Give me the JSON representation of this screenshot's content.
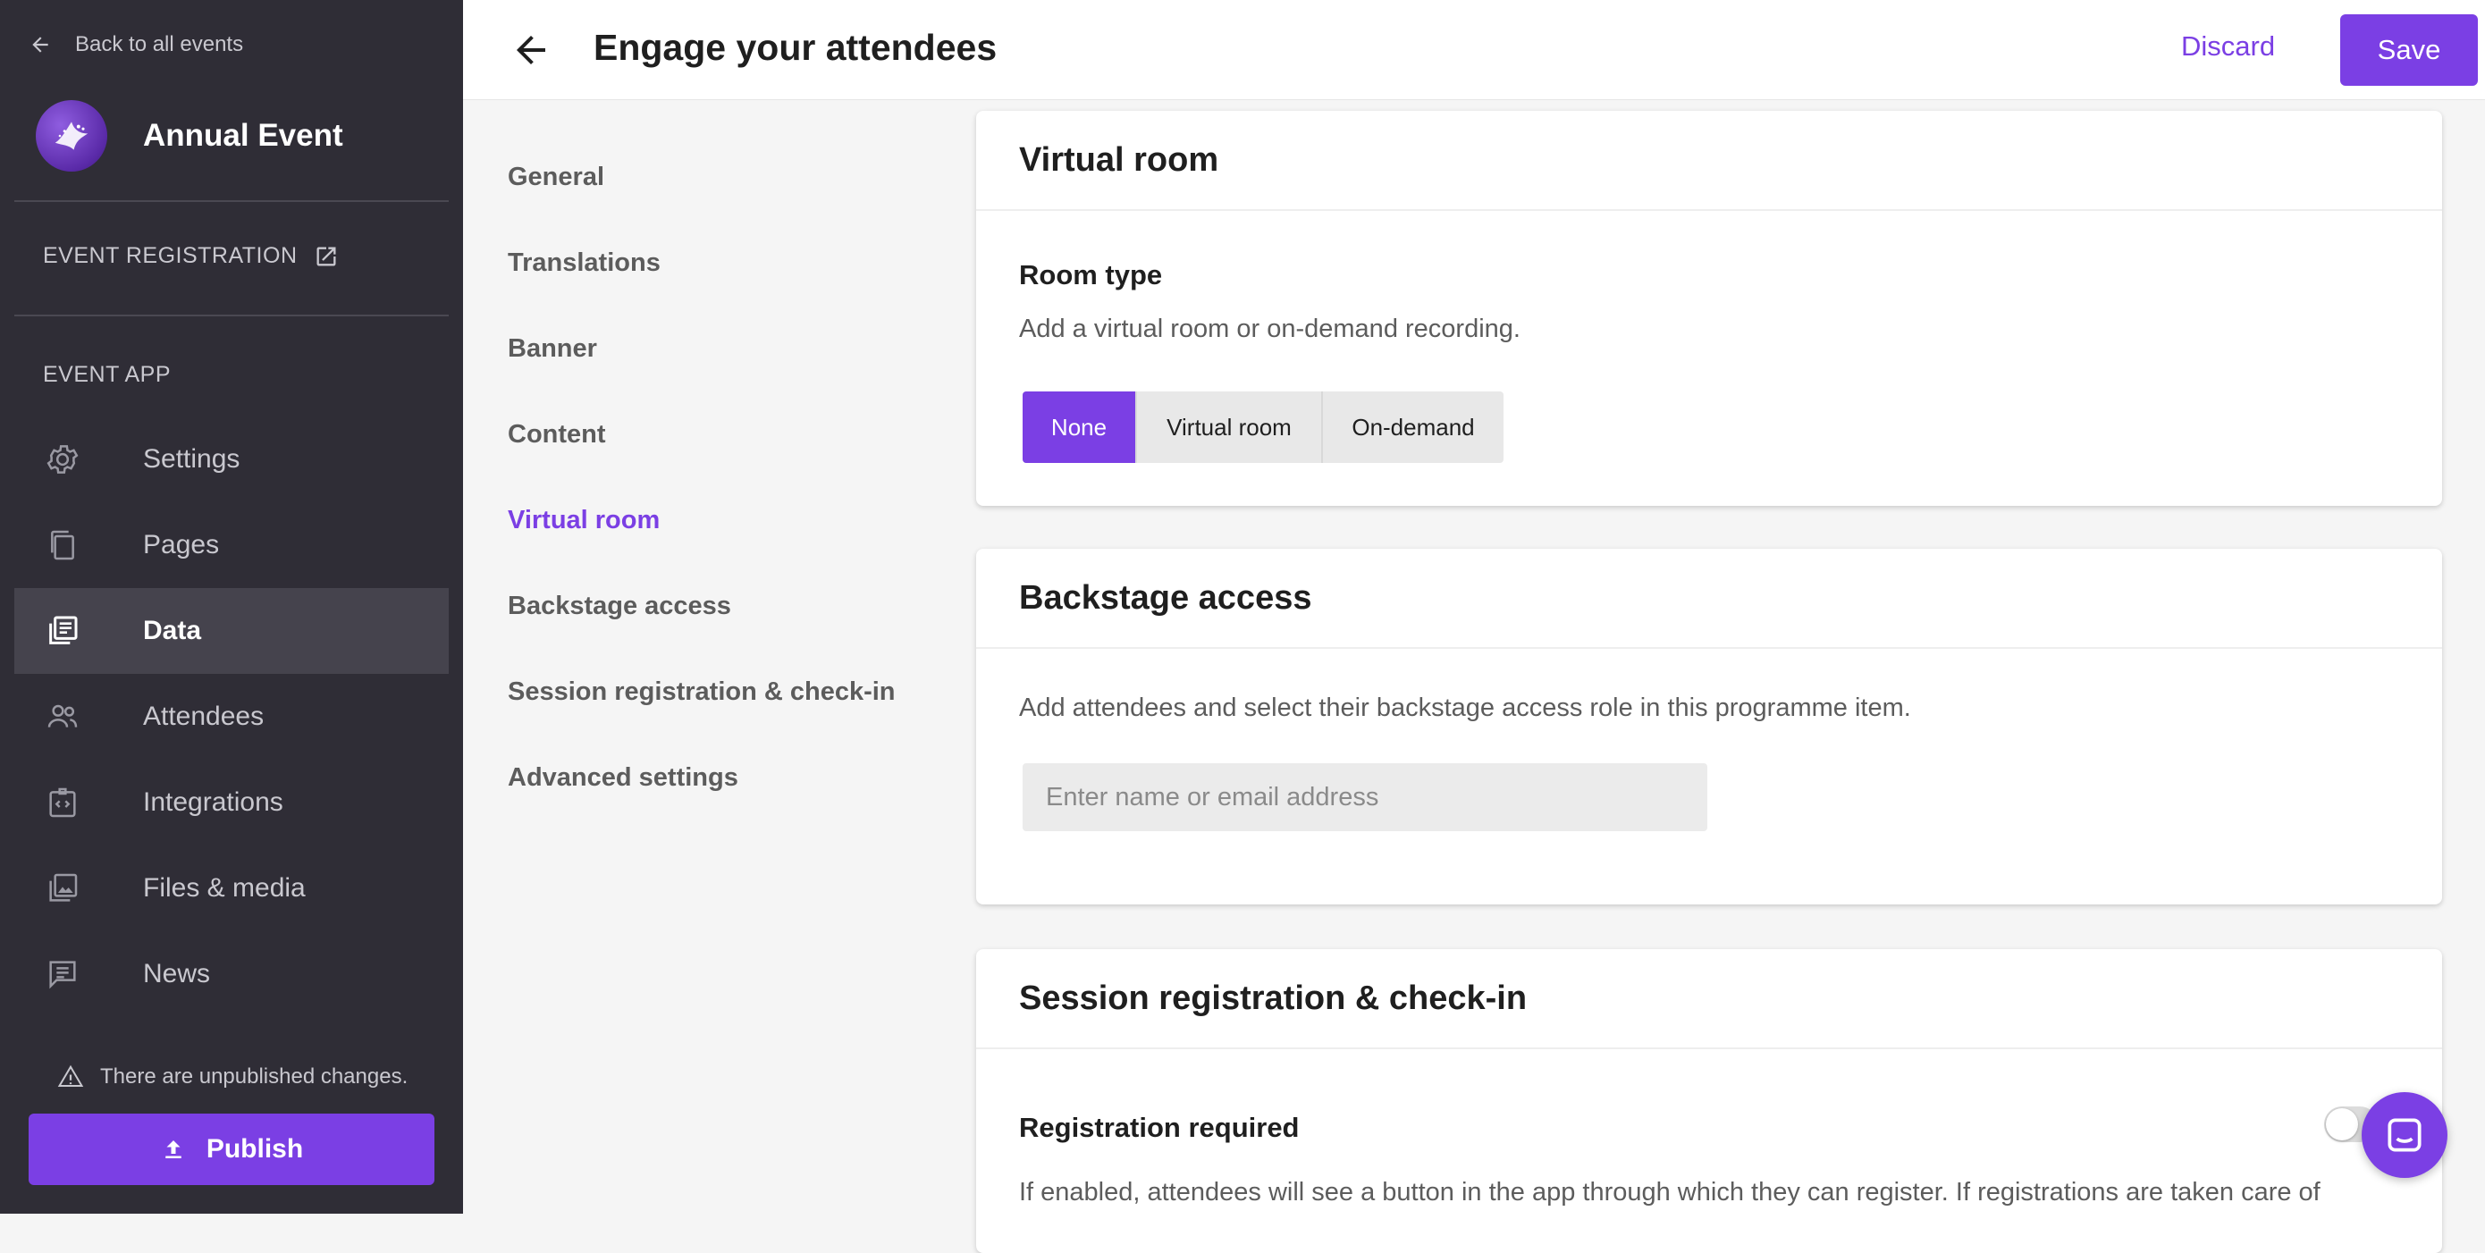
{
  "sidebar": {
    "back_label": "Back to all events",
    "event_name": "Annual Event",
    "registration_label": "EVENT REGISTRATION",
    "app_label": "EVENT APP",
    "items": [
      {
        "label": "Settings",
        "icon": "gear-icon"
      },
      {
        "label": "Pages",
        "icon": "pages-icon"
      },
      {
        "label": "Data",
        "icon": "data-icon",
        "active": true
      },
      {
        "label": "Attendees",
        "icon": "people-icon"
      },
      {
        "label": "Integrations",
        "icon": "integrations-icon"
      },
      {
        "label": "Files & media",
        "icon": "media-icon"
      },
      {
        "label": "News",
        "icon": "news-icon"
      }
    ],
    "unpublished_text": "There are unpublished changes.",
    "publish_label": "Publish"
  },
  "topbar": {
    "title": "Engage your attendees",
    "discard_label": "Discard",
    "save_label": "Save"
  },
  "subnav": {
    "items": [
      {
        "label": "General"
      },
      {
        "label": "Translations"
      },
      {
        "label": "Banner"
      },
      {
        "label": "Content"
      },
      {
        "label": "Virtual room",
        "active": true
      },
      {
        "label": "Backstage access"
      },
      {
        "label": "Session registration & check-in"
      },
      {
        "label": "Advanced settings"
      }
    ]
  },
  "virtual_room": {
    "title": "Virtual room",
    "room_type_title": "Room type",
    "room_type_desc": "Add a virtual room or on-demand recording.",
    "options": [
      "None",
      "Virtual room",
      "On-demand"
    ],
    "selected": "None"
  },
  "backstage": {
    "title": "Backstage access",
    "desc": "Add attendees and select their backstage access role in this programme item.",
    "input_placeholder": "Enter name or email address"
  },
  "session_registration": {
    "title": "Session registration & check-in",
    "registration_title": "Registration required",
    "registration_desc": "If enabled, attendees will see a button in the app through which they can register. If registrations are taken care of"
  },
  "colors": {
    "accent": "#7b3fe4",
    "sidebar_bg": "#2f2d36"
  }
}
